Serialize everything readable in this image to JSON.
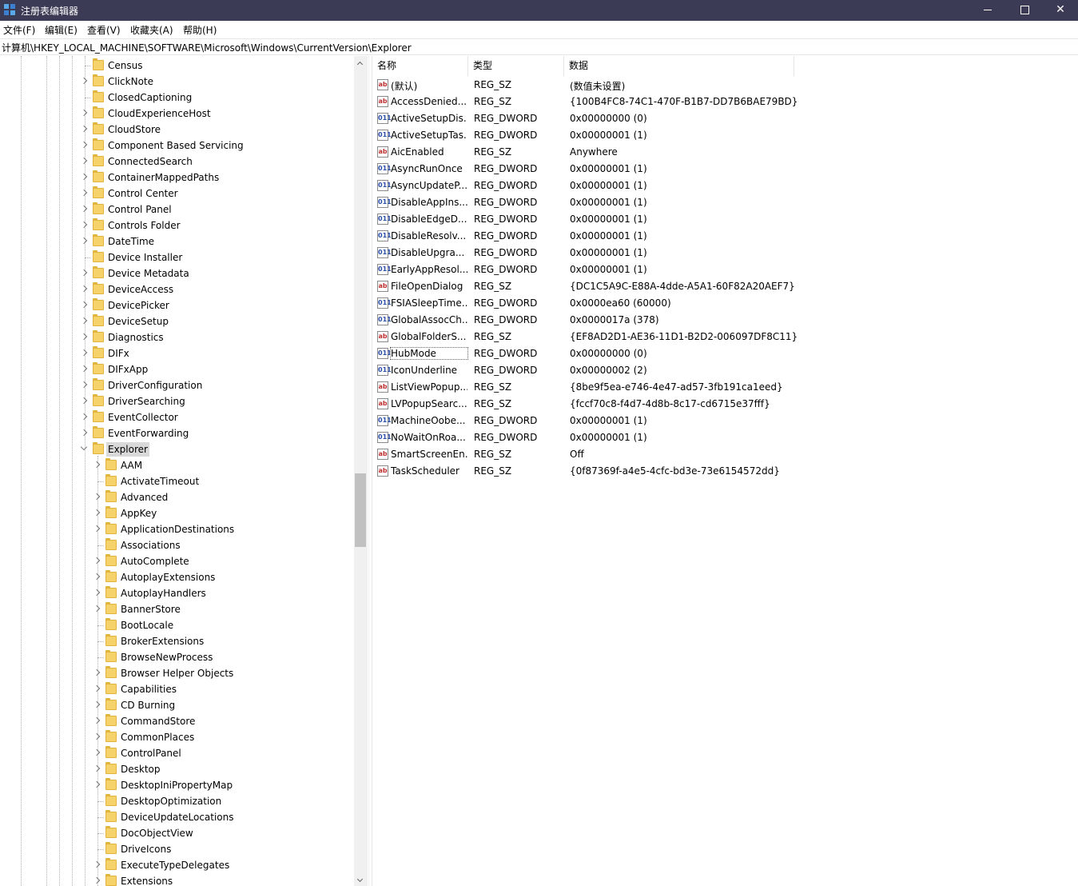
{
  "window": {
    "title": "注册表编辑器",
    "min_glyph": "",
    "max_glyph": "",
    "close_glyph": "✕"
  },
  "menu": [
    "文件(F)",
    "编辑(E)",
    "查看(V)",
    "收藏夹(A)",
    "帮助(H)"
  ],
  "address": "计算机\\HKEY_LOCAL_MACHINE\\SOFTWARE\\Microsoft\\Windows\\CurrentVersion\\Explorer",
  "tree": {
    "parent_items": [
      {
        "label": "Census",
        "expandable": false
      },
      {
        "label": "ClickNote",
        "expandable": true
      },
      {
        "label": "ClosedCaptioning",
        "expandable": false
      },
      {
        "label": "CloudExperienceHost",
        "expandable": true
      },
      {
        "label": "CloudStore",
        "expandable": true
      },
      {
        "label": "Component Based Servicing",
        "expandable": true
      },
      {
        "label": "ConnectedSearch",
        "expandable": true
      },
      {
        "label": "ContainerMappedPaths",
        "expandable": true
      },
      {
        "label": "Control Center",
        "expandable": true
      },
      {
        "label": "Control Panel",
        "expandable": true
      },
      {
        "label": "Controls Folder",
        "expandable": true
      },
      {
        "label": "DateTime",
        "expandable": true
      },
      {
        "label": "Device Installer",
        "expandable": false
      },
      {
        "label": "Device Metadata",
        "expandable": true
      },
      {
        "label": "DeviceAccess",
        "expandable": true
      },
      {
        "label": "DevicePicker",
        "expandable": true
      },
      {
        "label": "DeviceSetup",
        "expandable": true
      },
      {
        "label": "Diagnostics",
        "expandable": true
      },
      {
        "label": "DIFx",
        "expandable": true
      },
      {
        "label": "DIFxApp",
        "expandable": true
      },
      {
        "label": "DriverConfiguration",
        "expandable": true
      },
      {
        "label": "DriverSearching",
        "expandable": true
      },
      {
        "label": "EventCollector",
        "expandable": true
      },
      {
        "label": "EventForwarding",
        "expandable": true
      },
      {
        "label": "Explorer",
        "expandable": true,
        "open": true,
        "selected": true
      }
    ],
    "child_items": [
      {
        "label": "AAM",
        "expandable": true
      },
      {
        "label": "ActivateTimeout",
        "expandable": false
      },
      {
        "label": "Advanced",
        "expandable": true
      },
      {
        "label": "AppKey",
        "expandable": true
      },
      {
        "label": "ApplicationDestinations",
        "expandable": true
      },
      {
        "label": "Associations",
        "expandable": false
      },
      {
        "label": "AutoComplete",
        "expandable": true
      },
      {
        "label": "AutoplayExtensions",
        "expandable": true
      },
      {
        "label": "AutoplayHandlers",
        "expandable": true
      },
      {
        "label": "BannerStore",
        "expandable": true
      },
      {
        "label": "BootLocale",
        "expandable": false
      },
      {
        "label": "BrokerExtensions",
        "expandable": false
      },
      {
        "label": "BrowseNewProcess",
        "expandable": false
      },
      {
        "label": "Browser Helper Objects",
        "expandable": true
      },
      {
        "label": "Capabilities",
        "expandable": true
      },
      {
        "label": "CD Burning",
        "expandable": true
      },
      {
        "label": "CommandStore",
        "expandable": true
      },
      {
        "label": "CommonPlaces",
        "expandable": true
      },
      {
        "label": "ControlPanel",
        "expandable": true
      },
      {
        "label": "Desktop",
        "expandable": true
      },
      {
        "label": "DesktopIniPropertyMap",
        "expandable": true
      },
      {
        "label": "DesktopOptimization",
        "expandable": false
      },
      {
        "label": "DeviceUpdateLocations",
        "expandable": false
      },
      {
        "label": "DocObjectView",
        "expandable": false
      },
      {
        "label": "DriveIcons",
        "expandable": false
      },
      {
        "label": "ExecuteTypeDelegates",
        "expandable": true
      },
      {
        "label": "Extensions",
        "expandable": true
      }
    ]
  },
  "list": {
    "columns": [
      "名称",
      "类型",
      "数据"
    ],
    "rows": [
      {
        "icon": "string-value-icon",
        "kind": "sz",
        "name": "(默认)",
        "type": "REG_SZ",
        "data": "(数值未设置)"
      },
      {
        "icon": "string-value-icon",
        "kind": "sz",
        "name": "AccessDenied...",
        "type": "REG_SZ",
        "data": "{100B4FC8-74C1-470F-B1B7-DD7B6BAE79BD}"
      },
      {
        "icon": "binary-value-icon",
        "kind": "dw",
        "name": "ActiveSetupDis...",
        "type": "REG_DWORD",
        "data": "0x00000000 (0)"
      },
      {
        "icon": "binary-value-icon",
        "kind": "dw",
        "name": "ActiveSetupTas...",
        "type": "REG_DWORD",
        "data": "0x00000001 (1)"
      },
      {
        "icon": "string-value-icon",
        "kind": "sz",
        "name": "AicEnabled",
        "type": "REG_SZ",
        "data": "Anywhere"
      },
      {
        "icon": "binary-value-icon",
        "kind": "dw",
        "name": "AsyncRunOnce",
        "type": "REG_DWORD",
        "data": "0x00000001 (1)"
      },
      {
        "icon": "binary-value-icon",
        "kind": "dw",
        "name": "AsyncUpdateP...",
        "type": "REG_DWORD",
        "data": "0x00000001 (1)"
      },
      {
        "icon": "binary-value-icon",
        "kind": "dw",
        "name": "DisableAppIns...",
        "type": "REG_DWORD",
        "data": "0x00000001 (1)"
      },
      {
        "icon": "binary-value-icon",
        "kind": "dw",
        "name": "DisableEdgeD...",
        "type": "REG_DWORD",
        "data": "0x00000001 (1)"
      },
      {
        "icon": "binary-value-icon",
        "kind": "dw",
        "name": "DisableResolv...",
        "type": "REG_DWORD",
        "data": "0x00000001 (1)"
      },
      {
        "icon": "binary-value-icon",
        "kind": "dw",
        "name": "DisableUpgra...",
        "type": "REG_DWORD",
        "data": "0x00000001 (1)"
      },
      {
        "icon": "binary-value-icon",
        "kind": "dw",
        "name": "EarlyAppResol...",
        "type": "REG_DWORD",
        "data": "0x00000001 (1)"
      },
      {
        "icon": "string-value-icon",
        "kind": "sz",
        "name": "FileOpenDialog",
        "type": "REG_SZ",
        "data": "{DC1C5A9C-E88A-4dde-A5A1-60F82A20AEF7}"
      },
      {
        "icon": "binary-value-icon",
        "kind": "dw",
        "name": "FSIASleepTime...",
        "type": "REG_DWORD",
        "data": "0x0000ea60 (60000)"
      },
      {
        "icon": "binary-value-icon",
        "kind": "dw",
        "name": "GlobalAssocCh...",
        "type": "REG_DWORD",
        "data": "0x0000017a (378)"
      },
      {
        "icon": "string-value-icon",
        "kind": "sz",
        "name": "GlobalFolderS...",
        "type": "REG_SZ",
        "data": "{EF8AD2D1-AE36-11D1-B2D2-006097DF8C11}"
      },
      {
        "icon": "binary-value-icon",
        "kind": "dw",
        "name": "HubMode",
        "type": "REG_DWORD",
        "data": "0x00000000 (0)",
        "focused": true
      },
      {
        "icon": "binary-value-icon",
        "kind": "dw",
        "name": "IconUnderline",
        "type": "REG_DWORD",
        "data": "0x00000002 (2)"
      },
      {
        "icon": "string-value-icon",
        "kind": "sz",
        "name": "ListViewPopup...",
        "type": "REG_SZ",
        "data": "{8be9f5ea-e746-4e47-ad57-3fb191ca1eed}"
      },
      {
        "icon": "string-value-icon",
        "kind": "sz",
        "name": "LVPopupSearc...",
        "type": "REG_SZ",
        "data": "{fccf70c8-f4d7-4d8b-8c17-cd6715e37fff}"
      },
      {
        "icon": "binary-value-icon",
        "kind": "dw",
        "name": "MachineOobe...",
        "type": "REG_DWORD",
        "data": "0x00000001 (1)"
      },
      {
        "icon": "binary-value-icon",
        "kind": "dw",
        "name": "NoWaitOnRoa...",
        "type": "REG_DWORD",
        "data": "0x00000001 (1)"
      },
      {
        "icon": "string-value-icon",
        "kind": "sz",
        "name": "SmartScreenEn...",
        "type": "REG_SZ",
        "data": "Off"
      },
      {
        "icon": "string-value-icon",
        "kind": "sz",
        "name": "TaskScheduler",
        "type": "REG_SZ",
        "data": "{0f87369f-a4e5-4cfc-bd3e-73e6154572dd}"
      }
    ]
  },
  "icon_glyphs": {
    "sz": "ab",
    "dw": "011"
  }
}
